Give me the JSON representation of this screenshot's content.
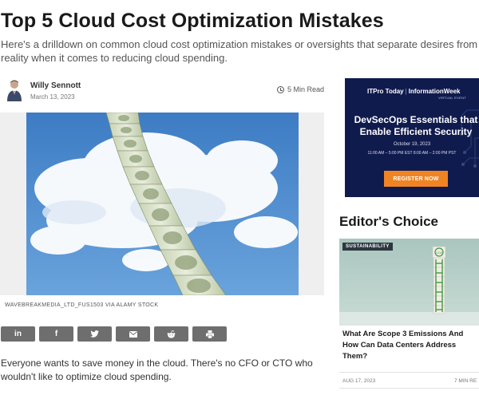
{
  "article": {
    "title": "Top 5 Cloud Cost Optimization Mistakes",
    "subtitle": "Here's a drilldown on common cloud cost optimization mistakes or oversights that separate desires from reality when it comes to reducing cloud spending.",
    "author": "Willy Sennott",
    "date": "March 13, 2023",
    "read_time": "5 Min Read",
    "image_caption": "WAVEBREAKMEDIA_LTD_FUS1503 VIA ALAMY STOCK",
    "body": "Everyone wants to save money in the cloud. There's no CFO or CTO who wouldn't like to optimize cloud spending."
  },
  "share": {
    "icons": [
      "linkedin-icon",
      "facebook-icon",
      "twitter-icon",
      "email-icon",
      "reddit-icon",
      "print-icon"
    ],
    "labels": [
      "in",
      "f",
      "",
      "",
      "",
      ""
    ]
  },
  "ad": {
    "brand_left": "ITPro Today",
    "brand_right": "InformationWeek",
    "event_type": "VIRTUAL EVENT",
    "headline_1": "DevSecOps Essentials that",
    "headline_2": "Enable Efficient Security",
    "event_date": "October 19, 2023",
    "event_times": "11:00 AM – 5:00 PM EST  8:00 AM – 2:00 PM PST",
    "cta": "REGISTER NOW",
    "colors": {
      "background": "#101b4d",
      "cta": "#f08423"
    }
  },
  "editors_choice": {
    "heading": "Editor's Choice",
    "card": {
      "badge": "SUSTAINABILITY",
      "title": "What Are Scope 3 Emissions And How Can Data Centers Address Them?",
      "date": "AUG 17, 2023",
      "read_time": "7 MIN RE"
    }
  }
}
